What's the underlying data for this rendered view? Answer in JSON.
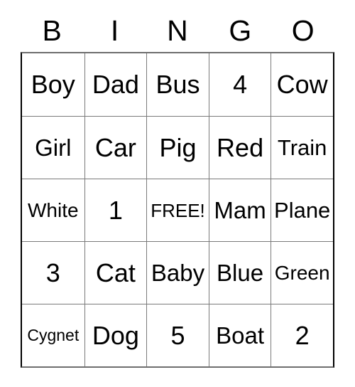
{
  "card": {
    "header": {
      "letters": [
        "B",
        "I",
        "N",
        "G",
        "O"
      ]
    },
    "columns": 5,
    "rows": 5,
    "free_space_label": "FREE!",
    "grid": [
      [
        {
          "text": "Boy",
          "size": "fs-xl"
        },
        {
          "text": "Dad",
          "size": "fs-xl"
        },
        {
          "text": "Bus",
          "size": "fs-xl"
        },
        {
          "text": "4",
          "size": "fs-xl"
        },
        {
          "text": "Cow",
          "size": "fs-xl"
        }
      ],
      [
        {
          "text": "Girl",
          "size": "fs-lg"
        },
        {
          "text": "Car",
          "size": "fs-xl"
        },
        {
          "text": "Pig",
          "size": "fs-xl"
        },
        {
          "text": "Red",
          "size": "fs-xl"
        },
        {
          "text": "Train",
          "size": "fs-md"
        }
      ],
      [
        {
          "text": "White",
          "size": "fs-sm"
        },
        {
          "text": "1",
          "size": "fs-xl"
        },
        {
          "text": "FREE!",
          "size": "fs-xs"
        },
        {
          "text": "Mam",
          "size": "fs-lg"
        },
        {
          "text": "Plane",
          "size": "fs-md"
        }
      ],
      [
        {
          "text": "3",
          "size": "fs-xl"
        },
        {
          "text": "Cat",
          "size": "fs-xl"
        },
        {
          "text": "Baby",
          "size": "fs-lg"
        },
        {
          "text": "Blue",
          "size": "fs-lg"
        },
        {
          "text": "Green",
          "size": "fs-sm"
        }
      ],
      [
        {
          "text": "Cygnet",
          "size": "fs-xxs"
        },
        {
          "text": "Dog",
          "size": "fs-xl"
        },
        {
          "text": "5",
          "size": "fs-xl"
        },
        {
          "text": "Boat",
          "size": "fs-lg"
        },
        {
          "text": "2",
          "size": "fs-xl"
        }
      ]
    ]
  },
  "colors": {
    "background": "#ffffff",
    "text": "#000000",
    "outer_border": "#000000",
    "inner_border": "#7a7a7a"
  }
}
